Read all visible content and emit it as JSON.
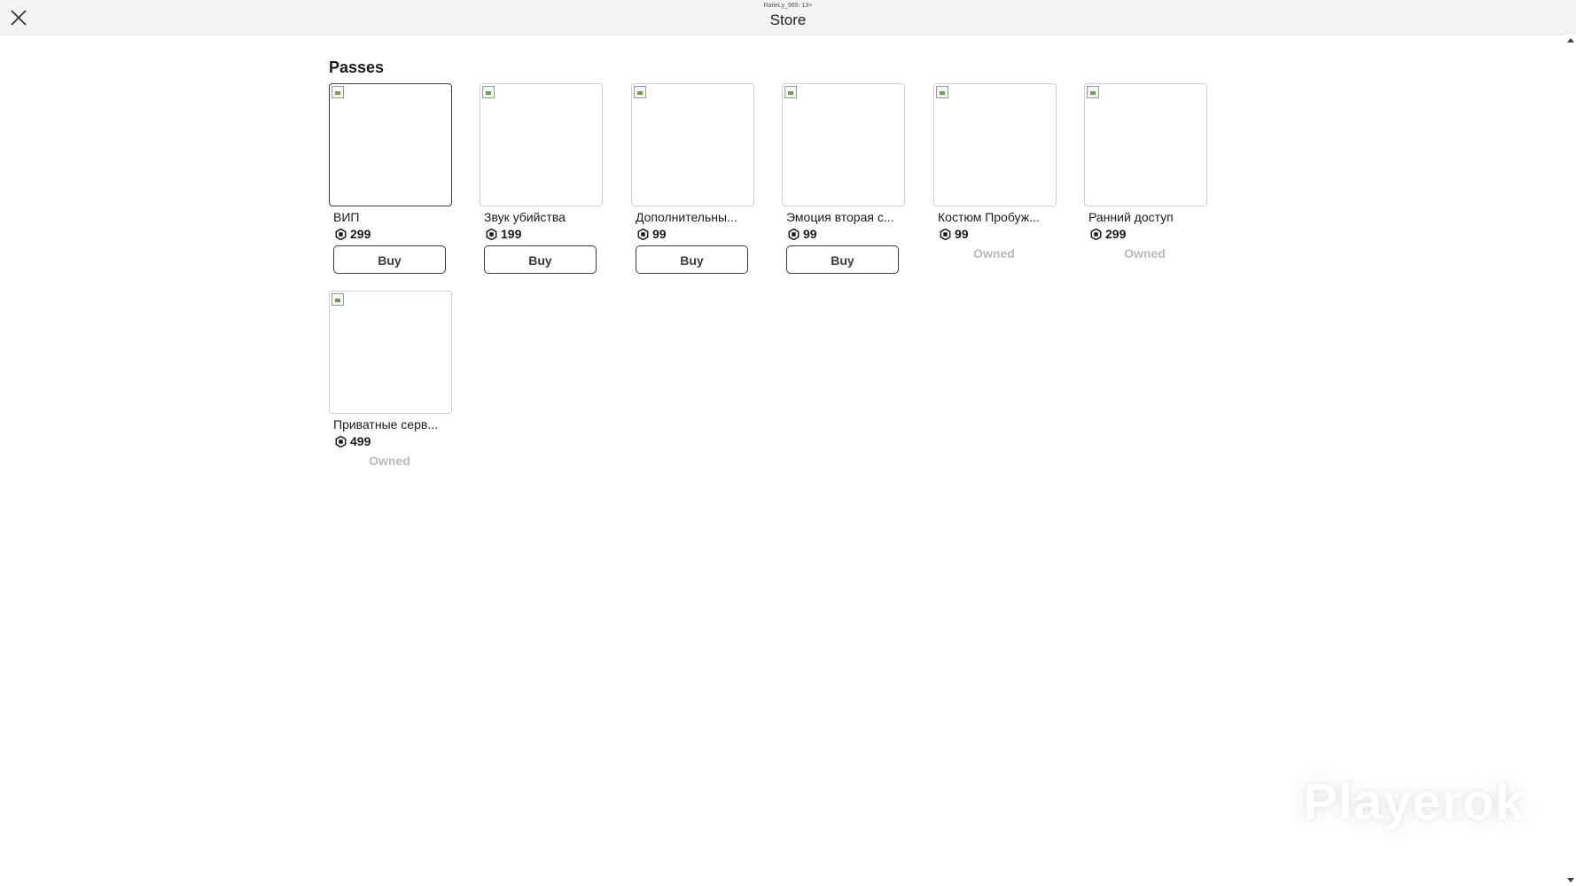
{
  "header": {
    "subtitle": "RatieLy_965: 13+",
    "title": "Store",
    "close_icon": "close-icon"
  },
  "section": {
    "title": "Passes"
  },
  "passes": [
    {
      "name": "ВИП",
      "price": "299",
      "action": "Buy",
      "owned": false,
      "selected": true
    },
    {
      "name": "Звук убийства",
      "price": "199",
      "action": "Buy",
      "owned": false,
      "selected": false
    },
    {
      "name": "Дополнительны...",
      "price": "99",
      "action": "Buy",
      "owned": false,
      "selected": false
    },
    {
      "name": "Эмоция вторая с...",
      "price": "99",
      "action": "Buy",
      "owned": false,
      "selected": false
    },
    {
      "name": "Костюм Пробуж...",
      "price": "99",
      "action": "Owned",
      "owned": true,
      "selected": false
    },
    {
      "name": "Ранний доступ",
      "price": "299",
      "action": "Owned",
      "owned": true,
      "selected": false
    },
    {
      "name": "Приватные серв...",
      "price": "499",
      "action": "Owned",
      "owned": true,
      "selected": false
    }
  ],
  "currency_icon": "robux-icon",
  "watermark": "Playerok",
  "colors": {
    "topbar": "#f2f3f4",
    "button_border": "#393b3d",
    "owned_text": "#b9b9b9"
  }
}
